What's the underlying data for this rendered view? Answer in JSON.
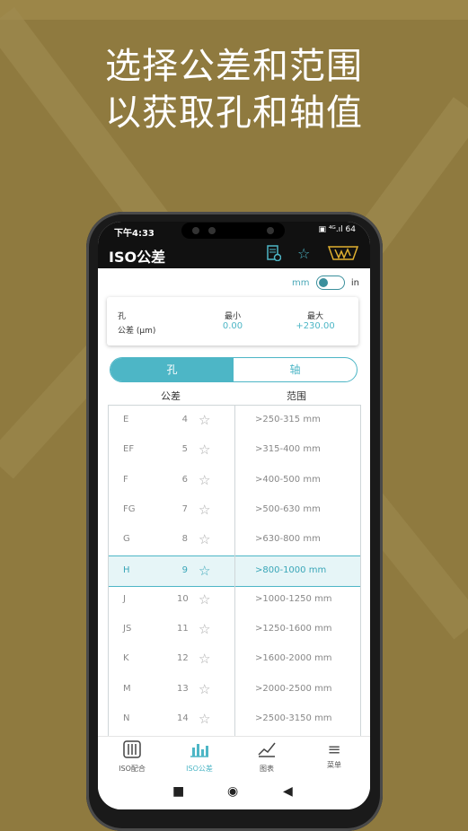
{
  "headline": {
    "line1": "选择公差和范围",
    "line2": "以获取孔和轴值"
  },
  "status": {
    "time": "下午4:33",
    "icons": "▣ ⁴ᴳ.ıl  64"
  },
  "appbar": {
    "title": "ISO公差",
    "icon1": "report-icon",
    "icon2": "star-icon",
    "icon3": "logo-icon"
  },
  "units": {
    "mm": "mm",
    "in": "in"
  },
  "card": {
    "label1": "孔",
    "label2": "公差 (μm)",
    "min_label": "最小",
    "min_value": "0.00",
    "max_label": "最大",
    "max_value": "+230.00"
  },
  "segment": {
    "hole": "孔",
    "shaft": "轴"
  },
  "columns": {
    "tolerance": "公差",
    "range": "范围"
  },
  "tolerances": [
    {
      "code": "E",
      "num": "4"
    },
    {
      "code": "EF",
      "num": "5"
    },
    {
      "code": "F",
      "num": "6"
    },
    {
      "code": "FG",
      "num": "7"
    },
    {
      "code": "G",
      "num": "8"
    },
    {
      "code": "H",
      "num": "9"
    },
    {
      "code": "J",
      "num": "10"
    },
    {
      "code": "JS",
      "num": "11"
    },
    {
      "code": "K",
      "num": "12"
    },
    {
      "code": "M",
      "num": "13"
    },
    {
      "code": "N",
      "num": "14"
    }
  ],
  "ranges": [
    ">250-315 mm",
    ">315-400 mm",
    ">400-500 mm",
    ">500-630 mm",
    ">630-800 mm",
    ">800-1000 mm",
    ">1000-1250 mm",
    ">1250-1600 mm",
    ">1600-2000 mm",
    ">2000-2500 mm",
    ">2500-3150 mm"
  ],
  "selected_index": 5,
  "bottomnav": [
    {
      "label": "ISO配合",
      "icon": "sliders-icon"
    },
    {
      "label": "ISO公差",
      "icon": "bar-chart-icon"
    },
    {
      "label": "图表",
      "icon": "line-chart-icon"
    },
    {
      "label": "菜单",
      "icon": "menu-icon"
    }
  ]
}
